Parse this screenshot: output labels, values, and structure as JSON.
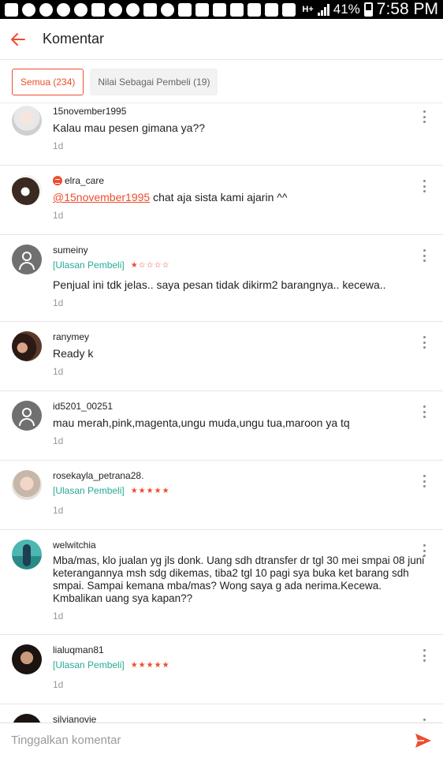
{
  "status_bar": {
    "network": "H+",
    "battery": "41%",
    "time": "7:58 PM"
  },
  "header": {
    "title": "Komentar",
    "back_icon": "arrow-left-icon"
  },
  "filters": [
    {
      "label": "Semua (234)",
      "active": true
    },
    {
      "label": "Nilai Sebagai Pembeli (19)",
      "active": false
    }
  ],
  "colors": {
    "accent": "#ee4d2d",
    "tag": "#26aa99"
  },
  "comments": [
    {
      "username": "15november1995",
      "seller": false,
      "tag": "",
      "rating": 0,
      "text": "Kalau mau pesen gimana ya??",
      "time": "1d"
    },
    {
      "username": "elra_care",
      "seller": true,
      "tag": "",
      "rating": 0,
      "mention": "@15november1995",
      "text": " chat aja sista kami ajarin ^^",
      "time": "1d"
    },
    {
      "username": "sumeiny",
      "seller": false,
      "tag": "[Ulasan Pembeli]",
      "stars": "★☆☆☆☆",
      "rating": 1,
      "text": "Penjual ini tdk jelas.. saya pesan tidak dikirm2 barangnya.. kecewa..",
      "time": "1d"
    },
    {
      "username": "ranymey",
      "seller": false,
      "tag": "",
      "rating": 0,
      "text": "Ready k",
      "time": "1d"
    },
    {
      "username": "id5201_00251",
      "seller": false,
      "tag": "",
      "rating": 0,
      "text": "mau merah,pink,magenta,ungu muda,ungu tua,maroon ya tq",
      "time": "1d"
    },
    {
      "username": "rosekayla_petrana28.",
      "seller": false,
      "tag": "[Ulasan Pembeli]",
      "stars": "★★★★★",
      "rating": 5,
      "text": "",
      "time": "1d"
    },
    {
      "username": "welwitchia",
      "seller": false,
      "tag": "",
      "rating": 0,
      "text": "Mba/mas, klo jualan yg jls donk. Uang sdh dtransfer dr tgl 30 mei smpai 08 juni keterangannya msh sdg dikemas, tiba2 tgl 10 pagi sya buka ket barang sdh smpai. Sampai kemana mba/mas? Wong saya g ada nerima.Kecewa. Kmbalikan uang sya kapan??",
      "time": "1d"
    },
    {
      "username": "lialuqman81",
      "seller": false,
      "tag": "[Ulasan Pembeli]",
      "stars": "★★★★★",
      "rating": 5,
      "text": "",
      "time": "1d"
    },
    {
      "username": "silvianovie",
      "seller": false,
      "tag": "",
      "rating": 0,
      "text": "",
      "time": ""
    }
  ],
  "composer": {
    "placeholder": "Tinggalkan komentar",
    "send_icon": "send-icon"
  }
}
